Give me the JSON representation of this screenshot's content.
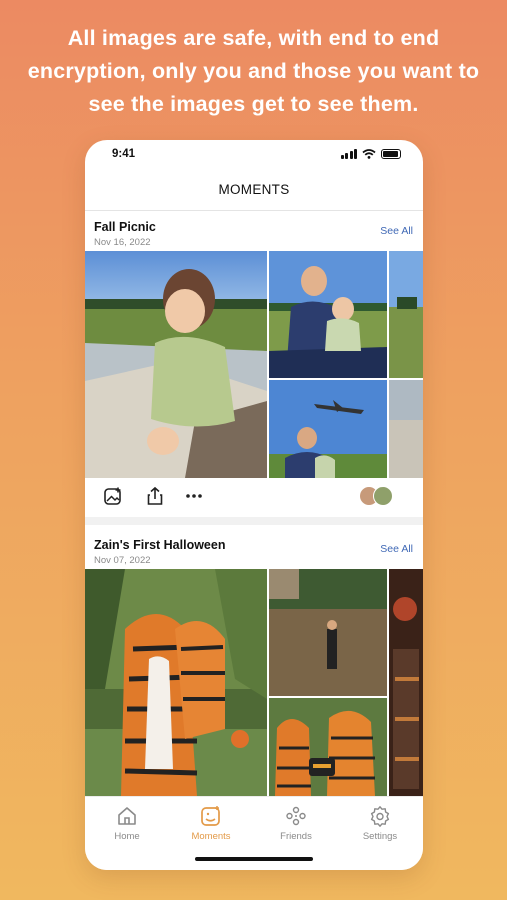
{
  "headline": "All images are safe, with end to end encryption, only you and those you want to see the images get to see them.",
  "status_bar": {
    "time": "9:41"
  },
  "nav": {
    "title": "MOMENTS"
  },
  "moments": [
    {
      "title": "Fall Picnic",
      "date": "Nov 16, 2022",
      "see_all": "See All"
    },
    {
      "title": "Zain's First Halloween",
      "date": "Nov 07, 2022",
      "see_all": "See All"
    }
  ],
  "tabs": [
    {
      "label": "Home",
      "icon": "home-icon"
    },
    {
      "label": "Moments",
      "icon": "moments-icon",
      "active": true
    },
    {
      "label": "Friends",
      "icon": "friends-icon"
    },
    {
      "label": "Settings",
      "icon": "settings-icon"
    }
  ],
  "colors": {
    "accent": "#e39a48",
    "link": "#3f68b5",
    "background_top": "#ec8a62",
    "background_bottom": "#f0b85f"
  }
}
